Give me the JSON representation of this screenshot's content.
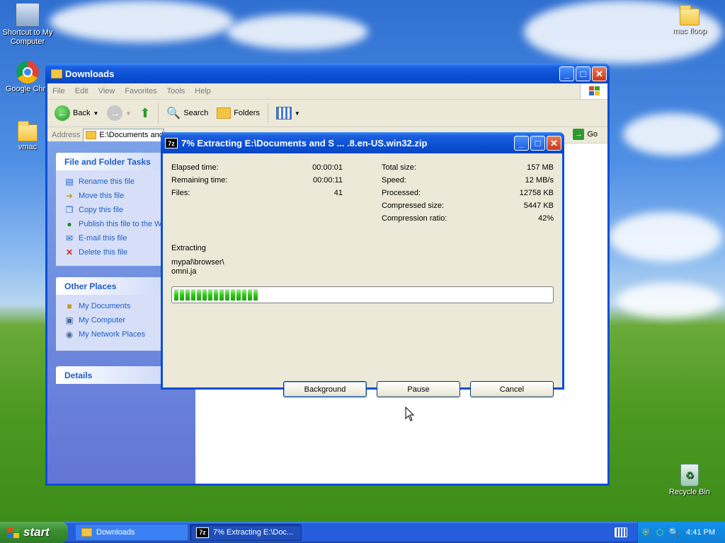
{
  "desktop": {
    "icons": [
      {
        "label": "Shortcut to My Computer"
      },
      {
        "label": "Google Chro"
      },
      {
        "label": "vmac"
      },
      {
        "label": "mac floop"
      },
      {
        "label": "Recycle Bin"
      }
    ]
  },
  "explorer": {
    "title": "Downloads",
    "menu": [
      "File",
      "Edit",
      "View",
      "Favorites",
      "Tools",
      "Help"
    ],
    "toolbar": {
      "back": "Back",
      "search": "Search",
      "folders": "Folders"
    },
    "address": {
      "label": "Address",
      "value": "E:\\Documents and",
      "go": "Go"
    },
    "file_tasks": {
      "title": "File and Folder Tasks",
      "items": [
        "Rename this file",
        "Move this file",
        "Copy this file",
        "Publish this file to the W",
        "E-mail this file",
        "Delete this file"
      ]
    },
    "other_places": {
      "title": "Other Places",
      "items": [
        "My Documents",
        "My Computer",
        "My Network Places"
      ]
    },
    "details": {
      "title": "Details"
    }
  },
  "dialog": {
    "title": "7% Extracting E:\\Documents and S ... .8.en-US.win32.zip",
    "icon_text": "7z",
    "left_stats": [
      {
        "label": "Elapsed time:",
        "value": "00:00:01"
      },
      {
        "label": "Remaining time:",
        "value": "00:00:11"
      },
      {
        "label": "Files:",
        "value": "41"
      }
    ],
    "right_stats": [
      {
        "label": "Total size:",
        "value": "157 MB"
      },
      {
        "label": "Speed:",
        "value": "12 MB/s"
      },
      {
        "label": "Processed:",
        "value": "12758 KB"
      },
      {
        "label": "Compressed size:",
        "value": "5447 KB"
      },
      {
        "label": "Compression ratio:",
        "value": "42%"
      }
    ],
    "status": "Extracting",
    "path_line1": "mypal\\browser\\",
    "path_line2": "omni.ja",
    "progress": 0.23,
    "buttons": {
      "background": "Background",
      "pause": "Pause",
      "cancel": "Cancel"
    }
  },
  "taskbar": {
    "start": "start",
    "tasks": [
      {
        "label": "Downloads"
      },
      {
        "label": "7% Extracting E:\\Doc..."
      }
    ],
    "clock": "4:41 PM"
  }
}
